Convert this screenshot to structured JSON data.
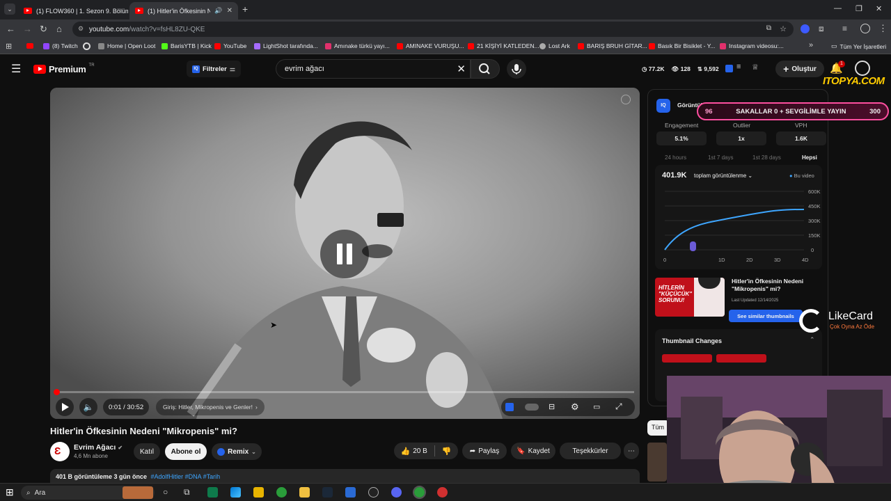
{
  "browser": {
    "tabs": [
      {
        "label": "(1) FLOW360 | 1. Sezon 9. Bölüm"
      },
      {
        "label": "(1) Hitler'in Öfkesinin Nedeni"
      }
    ],
    "url_host": "youtube.com",
    "url_path": "/watch?v=fsHL8ZU-QKE",
    "bookmarks": [
      {
        "label": "(8) Twitch",
        "color": "#9146ff"
      },
      {
        "label": "Home | Open Loot",
        "color": "#888"
      },
      {
        "label": "BarisYTB | Kick",
        "color": "#53fc18"
      },
      {
        "label": "YouTube",
        "color": "#ff0000"
      },
      {
        "label": "LightShot tarafında...",
        "color": "#a56bff"
      },
      {
        "label": "Amınake türkü yayı...",
        "color": "#e1306c"
      },
      {
        "label": "AMINAKE VURUŞU...",
        "color": "#ff0000"
      },
      {
        "label": "21 KİŞİYİ KATLEDEN...",
        "color": "#ff0000"
      },
      {
        "label": "Lost Ark",
        "color": "#aaa"
      },
      {
        "label": "BARIŞ BRUH GİTAR...",
        "color": "#ff0000"
      },
      {
        "label": "Basık Bir Bisiklet - Y...",
        "color": "#ff0000"
      },
      {
        "label": "Instagram videosu:...",
        "color": "#e1306c"
      }
    ],
    "all_bookmarks": "Tüm Yer İşaretleri"
  },
  "header": {
    "brand": "Premium",
    "region": "TR",
    "filters": "Filtreler",
    "search_value": "evrim ağacı",
    "stats": [
      "77.2K",
      "128",
      "9,592"
    ],
    "signin": "Oluştur",
    "notif_count": "1",
    "overlay_brand": "ITOPYA.COM"
  },
  "player": {
    "time": "0:01 / 30:52",
    "chapter": "Giriş: Hitler, Mikropenis ve Genler!",
    "progress": 0.001
  },
  "video": {
    "title": "Hitler'in Öfkesinin Nedeni \"Mikropenis\" mi?",
    "channel": "Evrim Ağacı",
    "subs": "4,6 Mn abone",
    "join": "Katıl",
    "subscribe": "Abone ol",
    "remix": "Remix",
    "likes": "20 B",
    "share": "Paylaş",
    "save": "Kaydet",
    "thanks": "Teşekkürler",
    "views_meta": "401 B görüntüleme  3 gün önce",
    "tags": "#AdolfHitler #DNA #Tarih",
    "all_chip": "Tüm"
  },
  "panel": {
    "tab": "Görüntül",
    "stream_banner": "SAKALLAR 0 + SEVGİLİMLE YAYIN",
    "stream_left": "96",
    "stream_right": "300",
    "kpis": [
      {
        "label": "Engagement",
        "value": "5.1%"
      },
      {
        "label": "Outlier",
        "value": "1x"
      },
      {
        "label": "VPH",
        "value": "1.6K"
      }
    ],
    "ranges": [
      "24 hours",
      "1st 7 days",
      "1st 28 days",
      "Hepsi"
    ],
    "total": "401.9K",
    "metric": "toplam görüntülenme",
    "legend": "Bu video",
    "yticks": [
      "600K",
      "450K",
      "300K",
      "150K",
      "0"
    ],
    "xticks": [
      "0",
      "1D",
      "2D",
      "3D",
      "4D"
    ],
    "thumb_title": "Hitler'in Öfkesinin Nedeni \"Mikropenis\" mi?",
    "thumb_text": "HİTLERİN \"KÜÇÜCÜK\" SORUNU!",
    "last_updated": "Last Updated 12/14/2025",
    "similar": "See similar thumbnails",
    "changes": "Thumbnail Changes"
  },
  "overlay": {
    "likecard": "LikeCard",
    "likecard_sub": "Çok Oyna  Az Öde"
  },
  "taskbar": {
    "search": "Ara"
  }
}
